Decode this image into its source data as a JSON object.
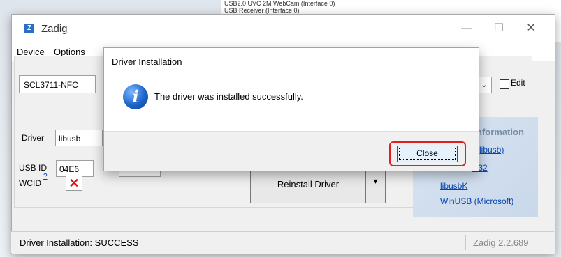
{
  "background_window": {
    "lines": [
      "USB2.0 UVC 2M WebCam (Interface 0)",
      "USB Receiver (Interface 0)"
    ]
  },
  "window": {
    "title": "Zadig",
    "icon_letter": "Z",
    "controls": {
      "minimize": "—",
      "maximize": "☐",
      "close": "✕"
    }
  },
  "menu": {
    "items": [
      "Device",
      "Options"
    ]
  },
  "device_combo": {
    "value": "SCL3711-NFC"
  },
  "edit_checkbox": {
    "label": "Edit",
    "checked": false
  },
  "driver_section": {
    "driver_label": "Driver",
    "driver_value": "libusb",
    "usbid_label": "USB ID",
    "usbid_value": "04E6",
    "wcid_label": "WCID",
    "wcid_help": "?",
    "wcid_status_glyph": "✕"
  },
  "install_button": {
    "label": "Reinstall Driver",
    "dropdown_glyph": "▾"
  },
  "info_panel": {
    "heading": "nformation",
    "links": [
      "(libusb)",
      "in32",
      "libusbK",
      "WinUSB (Microsoft)"
    ]
  },
  "status_bar": {
    "message": "Driver Installation: SUCCESS",
    "version": "Zadig 2.2.689"
  },
  "dialog": {
    "title": "Driver Installation",
    "message": "The driver was installed successfully.",
    "icon": "info-icon",
    "close_label": "Close"
  },
  "colors": {
    "highlight": "#e02020",
    "link": "#0645ad",
    "dialog_border": "#7fbf73",
    "info_icon": "#1e64c8"
  }
}
